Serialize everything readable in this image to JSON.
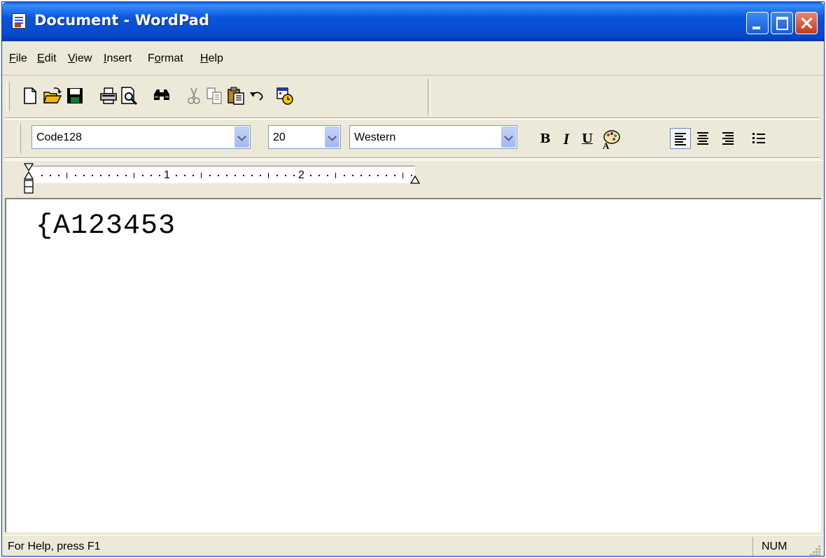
{
  "window": {
    "title": "Document - WordPad"
  },
  "menu": [
    {
      "pre": "",
      "key": "F",
      "post": "ile"
    },
    {
      "pre": "",
      "key": "E",
      "post": "dit"
    },
    {
      "pre": "",
      "key": "V",
      "post": "iew"
    },
    {
      "pre": "",
      "key": "I",
      "post": "nsert"
    },
    {
      "pre": "F",
      "key": "o",
      "post": "rmat"
    },
    {
      "pre": "",
      "key": "H",
      "post": "elp"
    }
  ],
  "toolbar": {
    "icons": [
      "new-document-icon",
      "open-folder-icon",
      "save-disk-icon",
      "print-icon",
      "print-preview-icon",
      "find-binoculars-icon",
      "cut-scissors-icon",
      "copy-icon",
      "paste-icon",
      "undo-icon",
      "insert-datetime-icon"
    ]
  },
  "format": {
    "font": "Code128",
    "size": "20",
    "script": "Western",
    "bold_label": "B",
    "italic_label": "I",
    "underline_label": "U"
  },
  "ruler": {
    "labels": [
      "1",
      "2"
    ]
  },
  "document": {
    "text": "{A123453"
  },
  "status": {
    "help": "For Help, press F1",
    "num": "NUM"
  },
  "colors": {
    "titlebar": "#0855dd",
    "close": "#c4391c",
    "chrome": "#ece9d8"
  }
}
